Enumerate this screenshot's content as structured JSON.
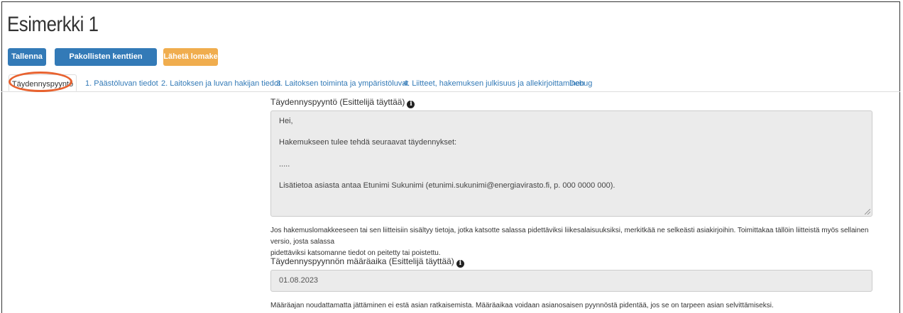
{
  "page": {
    "title": "Esimerkki 1"
  },
  "toolbar": {
    "save_label": "Tallenna",
    "check_label": "Pakollisten kenttien tarkastus",
    "send_label": "Lähetä lomake"
  },
  "tabs": [
    {
      "label": "Täydennyspyyntö"
    },
    {
      "label": "1. Päästöluvan tiedot"
    },
    {
      "label": "2. Laitoksen ja luvan hakijan tiedot"
    },
    {
      "label": "3. Laitoksen toiminta ja ympäristöluvat"
    },
    {
      "label": "4. Liitteet, hakemuksen julkisuus ja allekirjoittaminen"
    },
    {
      "label": "Debug"
    }
  ],
  "form": {
    "request_label": "Täydennyspyyntö (Esittelijä täyttää)",
    "request_lines": [
      "Hei,",
      "Hakemukseen tulee tehdä seuraavat täydennykset:",
      ".....",
      "Lisätietoa asiasta antaa Etunimi Sukunimi (etunimi.sukunimi@energiavirasto.fi, p. 000 0000 000)."
    ],
    "confidential_help_1": "Jos hakemuslomakkeeseen tai sen liitteisiin sisältyy tietoja, jotka katsotte salassa pidettäviksi liikesalaisuuksiksi, merkitkää ne selkeästi asiakirjoihin. Toimittakaa tällöin liitteistä myös sellainen versio, josta salassa",
    "confidential_help_2": "pidettäviksi katsomanne tiedot on peitetty tai poistettu.",
    "deadline_label": "Täydennyspyynnön määräaika (Esittelijä täyttää)",
    "deadline_value": "01.08.2023",
    "deadline_help": "Määräajan noudattamatta jättäminen ei estä asian ratkaisemista. Määräaikaa voidaan asianosaisen pyynnöstä pidentää, jos se on tarpeen asian selvittämiseksi."
  },
  "colors": {
    "primary": "#337ab7",
    "warning": "#f0ad4e",
    "highlight": "#e8622f"
  },
  "icons": {
    "info": "info-circle-icon"
  }
}
